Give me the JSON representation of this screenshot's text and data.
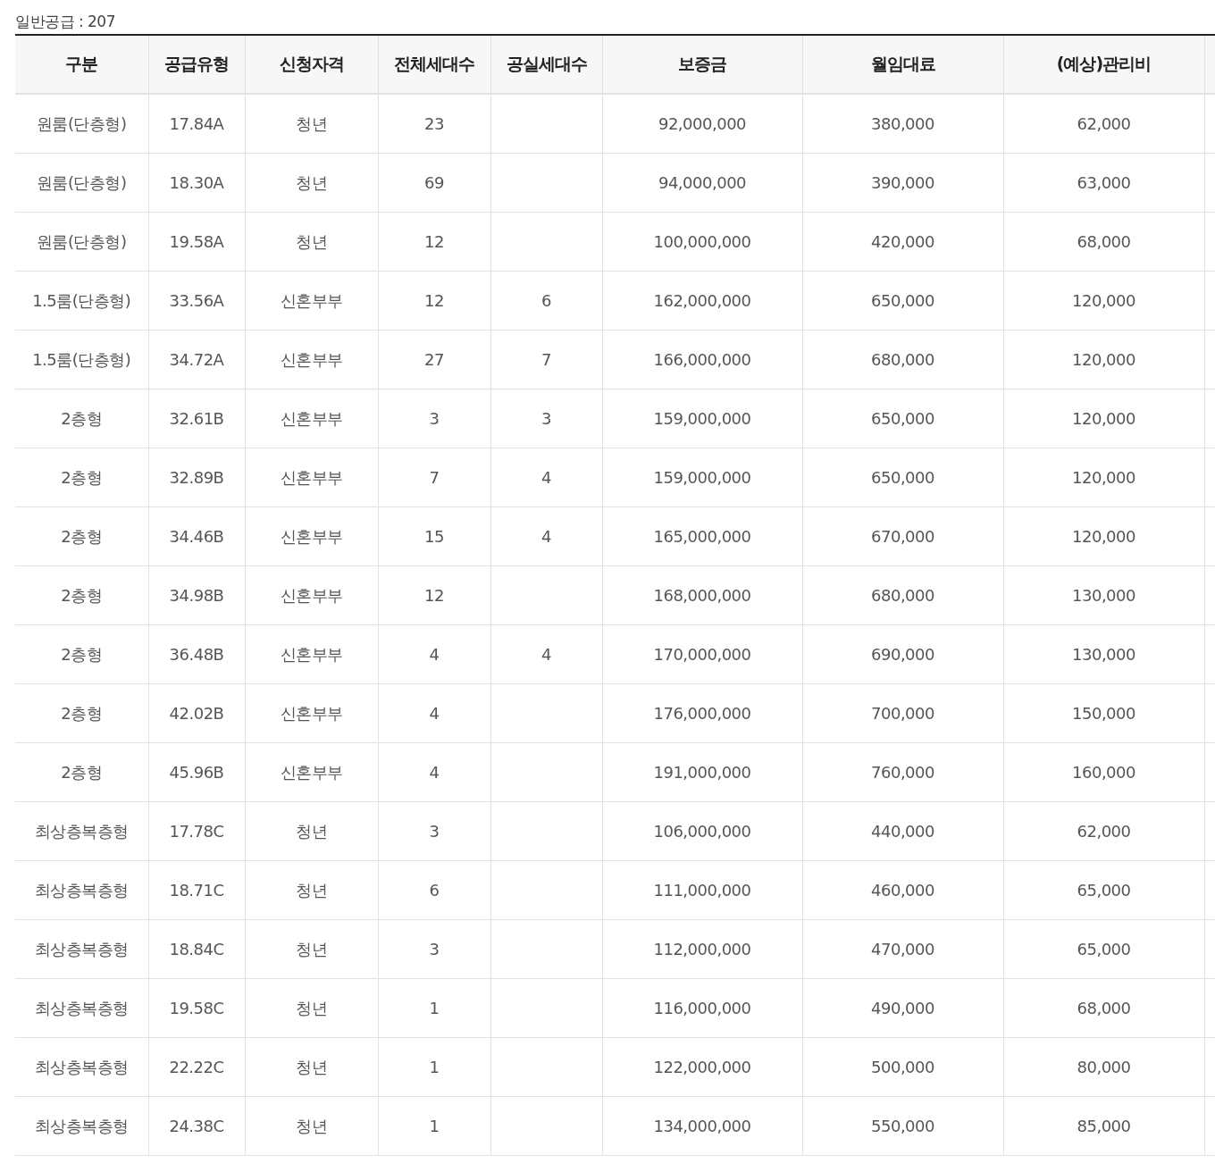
{
  "caption": "일반공급 : 207",
  "table": {
    "columns": [
      "구분",
      "공급유형",
      "신청자격",
      "전체세대수",
      "공실세대수",
      "보증금",
      "월임대료",
      "(예상)관리비"
    ],
    "rows": [
      [
        "원룸(단층형)",
        "17.84A",
        "청년",
        "23",
        "",
        "92,000,000",
        "380,000",
        "62,000"
      ],
      [
        "원룸(단층형)",
        "18.30A",
        "청년",
        "69",
        "",
        "94,000,000",
        "390,000",
        "63,000"
      ],
      [
        "원룸(단층형)",
        "19.58A",
        "청년",
        "12",
        "",
        "100,000,000",
        "420,000",
        "68,000"
      ],
      [
        "1.5룸(단층형)",
        "33.56A",
        "신혼부부",
        "12",
        "6",
        "162,000,000",
        "650,000",
        "120,000"
      ],
      [
        "1.5룸(단층형)",
        "34.72A",
        "신혼부부",
        "27",
        "7",
        "166,000,000",
        "680,000",
        "120,000"
      ],
      [
        "2층형",
        "32.61B",
        "신혼부부",
        "3",
        "3",
        "159,000,000",
        "650,000",
        "120,000"
      ],
      [
        "2층형",
        "32.89B",
        "신혼부부",
        "7",
        "4",
        "159,000,000",
        "650,000",
        "120,000"
      ],
      [
        "2층형",
        "34.46B",
        "신혼부부",
        "15",
        "4",
        "165,000,000",
        "670,000",
        "120,000"
      ],
      [
        "2층형",
        "34.98B",
        "신혼부부",
        "12",
        "",
        "168,000,000",
        "680,000",
        "130,000"
      ],
      [
        "2층형",
        "36.48B",
        "신혼부부",
        "4",
        "4",
        "170,000,000",
        "690,000",
        "130,000"
      ],
      [
        "2층형",
        "42.02B",
        "신혼부부",
        "4",
        "",
        "176,000,000",
        "700,000",
        "150,000"
      ],
      [
        "2층형",
        "45.96B",
        "신혼부부",
        "4",
        "",
        "191,000,000",
        "760,000",
        "160,000"
      ],
      [
        "최상층복층형",
        "17.78C",
        "청년",
        "3",
        "",
        "106,000,000",
        "440,000",
        "62,000"
      ],
      [
        "최상층복층형",
        "18.71C",
        "청년",
        "6",
        "",
        "111,000,000",
        "460,000",
        "65,000"
      ],
      [
        "최상층복층형",
        "18.84C",
        "청년",
        "3",
        "",
        "112,000,000",
        "470,000",
        "65,000"
      ],
      [
        "최상층복층형",
        "19.58C",
        "청년",
        "1",
        "",
        "116,000,000",
        "490,000",
        "68,000"
      ],
      [
        "최상층복층형",
        "22.22C",
        "청년",
        "1",
        "",
        "122,000,000",
        "500,000",
        "80,000"
      ],
      [
        "최상층복층형",
        "24.38C",
        "청년",
        "1",
        "",
        "134,000,000",
        "550,000",
        "85,000"
      ]
    ]
  }
}
